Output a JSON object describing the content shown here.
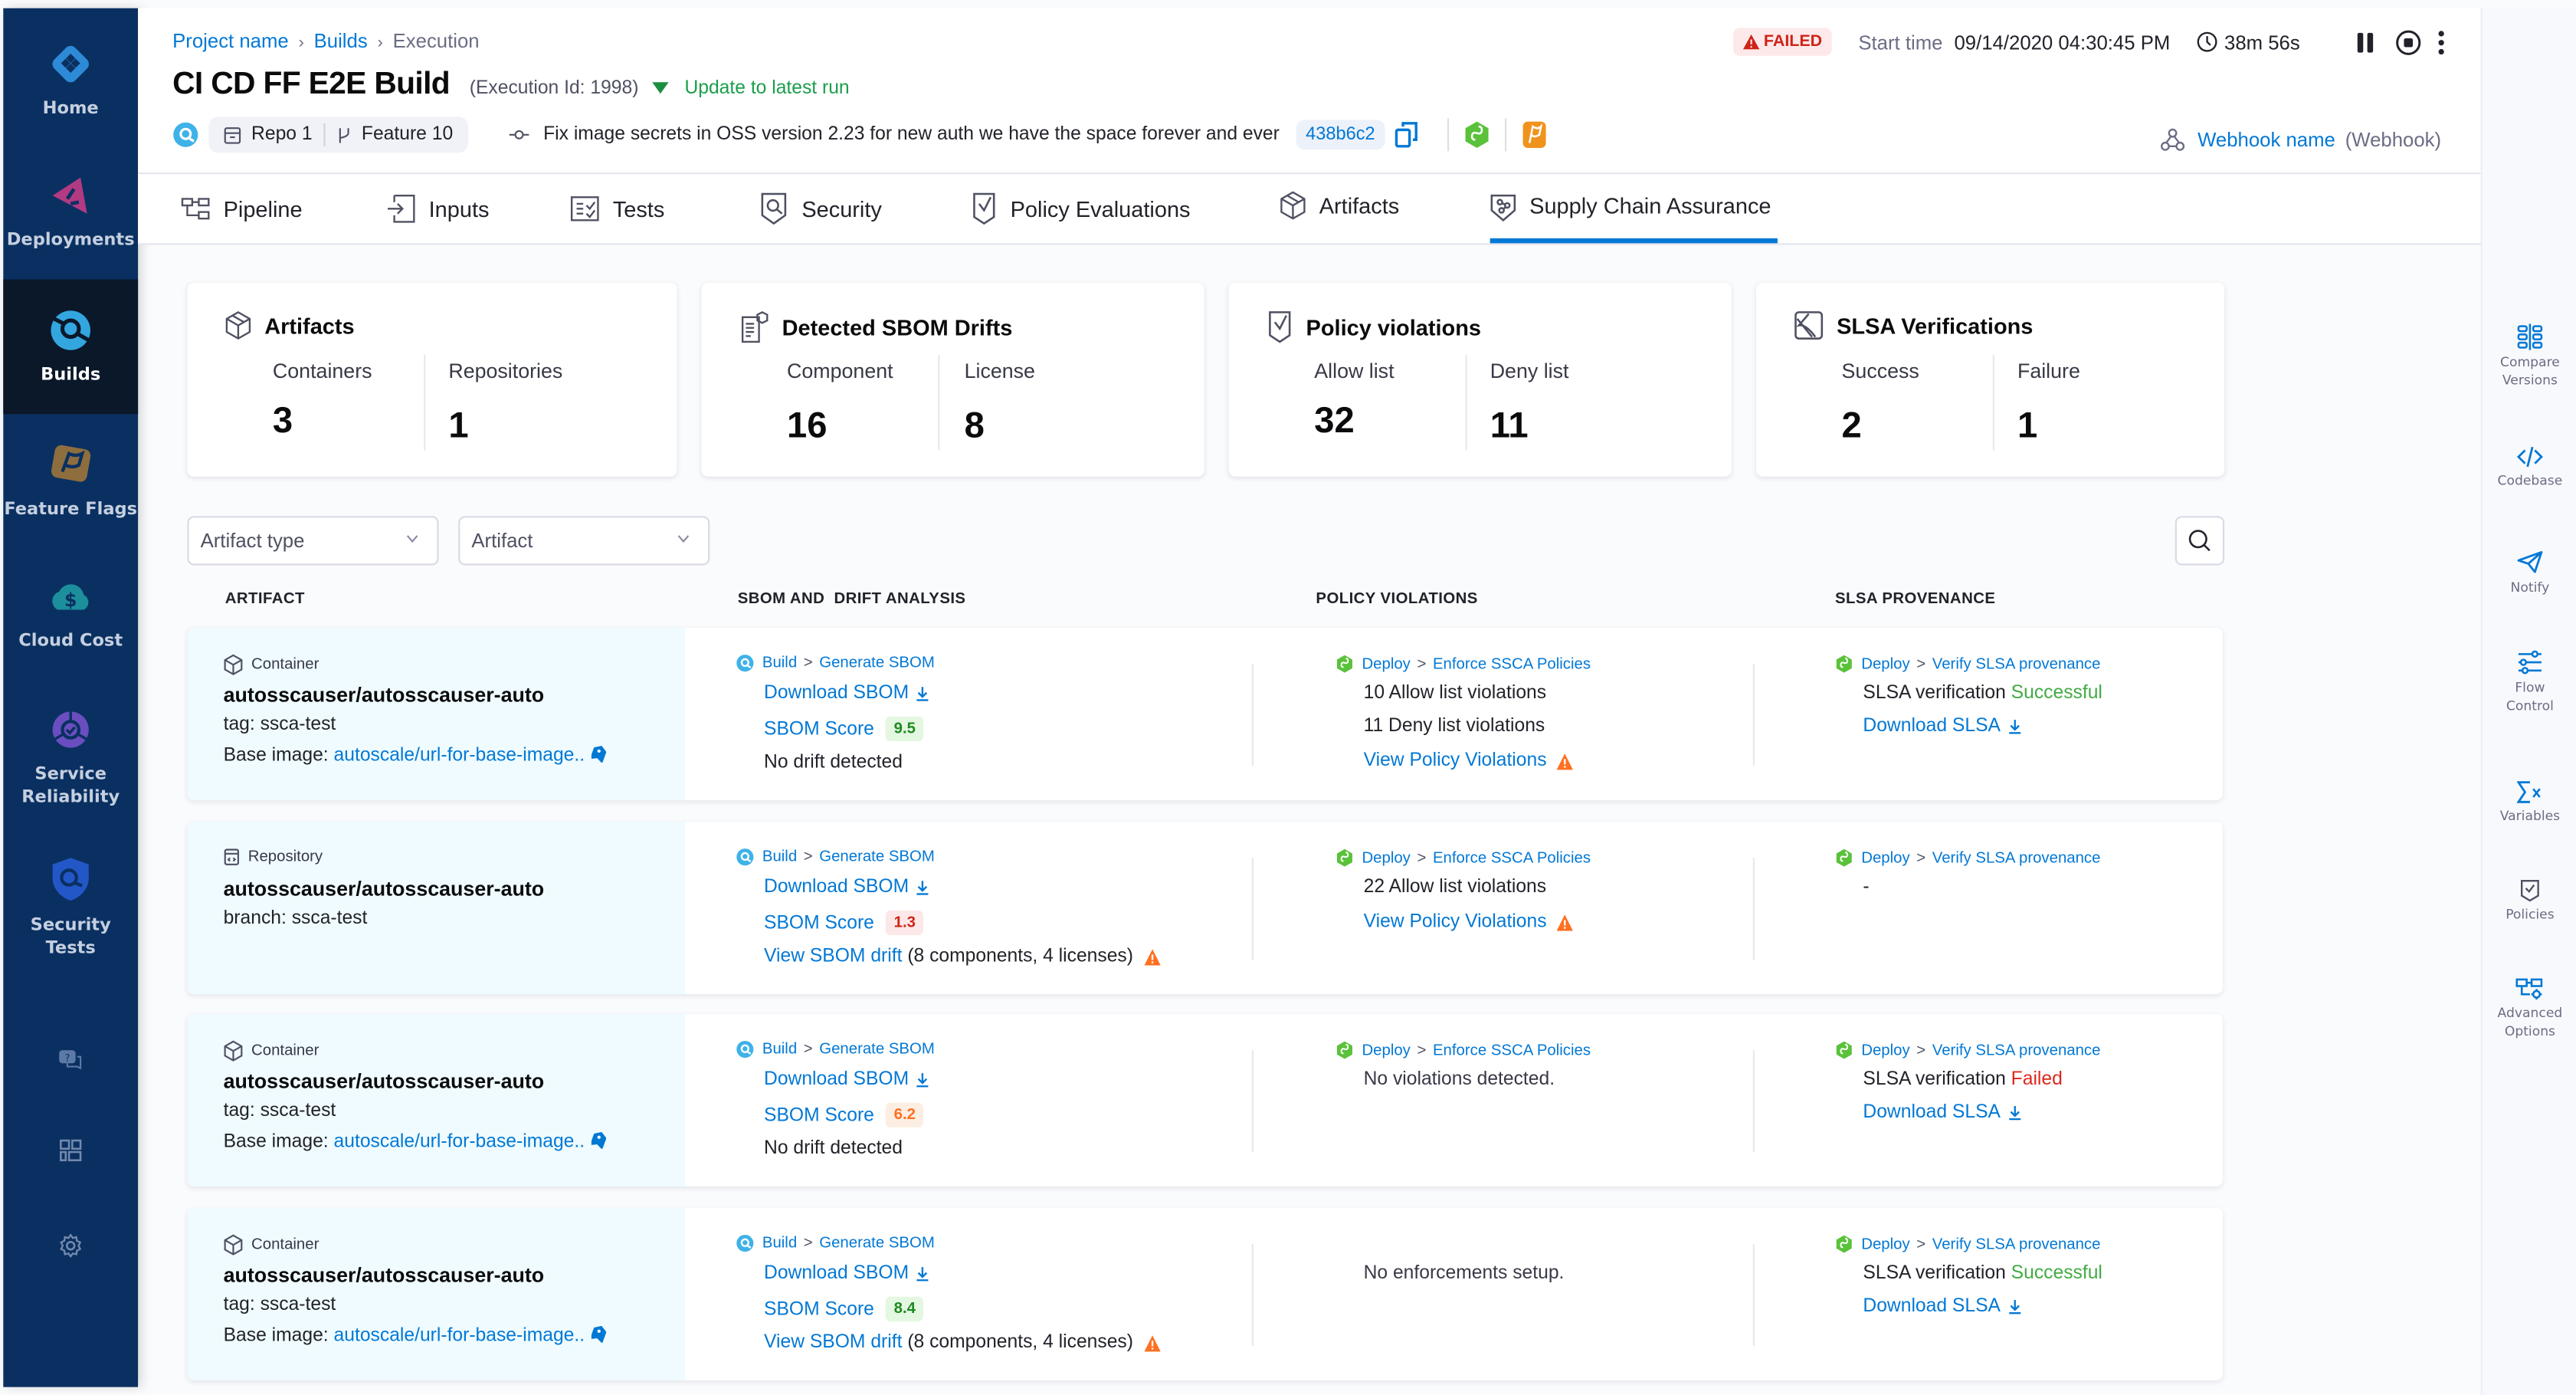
{
  "leftnav": {
    "items": [
      {
        "label": "Home",
        "icon": "home-icon"
      },
      {
        "label": "Deployments",
        "icon": "deployments-icon"
      },
      {
        "label": "Builds",
        "icon": "builds-icon",
        "active": true
      },
      {
        "label": "Feature Flags",
        "icon": "feature-flags-icon"
      },
      {
        "label": "Cloud Cost",
        "icon": "cloud-cost-icon"
      },
      {
        "label": "Service Reliability",
        "icon": "service-reliability-icon"
      },
      {
        "label": "Security Tests",
        "icon": "security-tests-icon"
      }
    ],
    "utility": [
      "help-icon",
      "dashboards-icon",
      "settings-icon"
    ]
  },
  "breadcrumb": [
    "Project name",
    "Builds",
    "Execution"
  ],
  "header": {
    "title": "CI CD FF E2E Build",
    "execution_id": "(Execution Id: 1998)",
    "update_link": "Update to latest run",
    "repo": "Repo 1",
    "branch": "Feature 10",
    "commit_message": "Fix image secrets in OSS version 2.23 for new auth we have the space forever and ever",
    "commit_sha": "438b6c2",
    "status": "FAILED",
    "start_time_label": "Start time",
    "start_time": "09/14/2020 04:30:45 PM",
    "duration": "38m 56s",
    "webhook_name": "Webhook name",
    "webhook_type": "(Webhook)"
  },
  "tabs": [
    {
      "label": "Pipeline",
      "icon": "pipeline-icon"
    },
    {
      "label": "Inputs",
      "icon": "inputs-icon"
    },
    {
      "label": "Tests",
      "icon": "tests-icon"
    },
    {
      "label": "Security",
      "icon": "security-icon"
    },
    {
      "label": "Policy Evaluations",
      "icon": "policy-icon"
    },
    {
      "label": "Artifacts",
      "icon": "artifacts-icon"
    },
    {
      "label": "Supply Chain Assurance",
      "icon": "supply-chain-icon",
      "active": true
    }
  ],
  "summary": [
    {
      "title": "Artifacts",
      "stats": [
        {
          "label": "Containers",
          "value": "3"
        },
        {
          "label": "Repositories",
          "value": "1"
        }
      ]
    },
    {
      "title": "Detected SBOM Drifts",
      "stats": [
        {
          "label": "Component",
          "value": "16"
        },
        {
          "label": "License",
          "value": "8"
        }
      ]
    },
    {
      "title": "Policy violations",
      "stats": [
        {
          "label": "Allow list",
          "value": "32"
        },
        {
          "label": "Deny list",
          "value": "11"
        }
      ]
    },
    {
      "title": "SLSA Verifications",
      "stats": [
        {
          "label": "Success",
          "value": "2"
        },
        {
          "label": "Failure",
          "value": "1"
        }
      ]
    }
  ],
  "filters": {
    "artifact_type": "Artifact type",
    "artifact": "Artifact"
  },
  "table": {
    "headers": [
      "ARTIFACT",
      "SBOM AND  DRIFT ANALYSIS",
      "POLICY VIOLATIONS",
      "SLSA PROVENANCE"
    ],
    "rows": [
      {
        "kind": "Container",
        "name": "autosscauser/autosscauser-auto",
        "line1_label": "tag:",
        "line1_value": "ssca-test",
        "base_label": "Base image:",
        "base_value": "autoscale/url-for-base-image..",
        "sbom_step": [
          "Build",
          "Generate SBOM"
        ],
        "download_sbom": "Download SBOM",
        "score_label": "SBOM Score",
        "score": "9.5",
        "score_level": "good",
        "drift_text": "No drift detected",
        "drift_link": "",
        "drift_detail": "",
        "policy_step": [
          "Deploy",
          "Enforce SSCA Policies"
        ],
        "policy_lines": [
          "10 Allow list violations",
          "11 Deny list violations"
        ],
        "policy_link": "View Policy Violations",
        "policy_empty": "",
        "slsa_step": [
          "Deploy",
          "Verify SLSA provenance"
        ],
        "slsa_label": "SLSA verification",
        "slsa_status": "Successful",
        "slsa_ok": true,
        "slsa_download": "Download SLSA"
      },
      {
        "kind": "Repository",
        "name": "autosscauser/autosscauser-auto",
        "line1_label": "branch:",
        "line1_value": "ssca-test",
        "base_label": "",
        "base_value": "",
        "sbom_step": [
          "Build",
          "Generate SBOM"
        ],
        "download_sbom": "Download SBOM",
        "score_label": "SBOM Score",
        "score": "1.3",
        "score_level": "bad",
        "drift_text": "",
        "drift_link": "View SBOM drift",
        "drift_detail": "(8 components, 4 licenses)",
        "policy_step": [
          "Deploy",
          "Enforce SSCA Policies"
        ],
        "policy_lines": [
          "22 Allow list violations"
        ],
        "policy_link": "View Policy Violations",
        "policy_empty": "",
        "slsa_step": [
          "Deploy",
          "Verify SLSA provenance"
        ],
        "slsa_label": "-",
        "slsa_status": "",
        "slsa_ok": true,
        "slsa_download": ""
      },
      {
        "kind": "Container",
        "name": "autosscauser/autosscauser-auto",
        "line1_label": "tag:",
        "line1_value": "ssca-test",
        "base_label": "Base image:",
        "base_value": "autoscale/url-for-base-image..",
        "sbom_step": [
          "Build",
          "Generate SBOM"
        ],
        "download_sbom": "Download SBOM",
        "score_label": "SBOM Score",
        "score": "6.2",
        "score_level": "mid",
        "drift_text": "No drift detected",
        "drift_link": "",
        "drift_detail": "",
        "policy_step": [
          "Deploy",
          "Enforce SSCA Policies"
        ],
        "policy_lines": [],
        "policy_link": "",
        "policy_empty": "No violations detected.",
        "slsa_step": [
          "Deploy",
          "Verify SLSA provenance"
        ],
        "slsa_label": "SLSA verification",
        "slsa_status": "Failed",
        "slsa_ok": false,
        "slsa_download": "Download SLSA"
      },
      {
        "kind": "Container",
        "name": "autosscauser/autosscauser-auto",
        "line1_label": "tag:",
        "line1_value": "ssca-test",
        "base_label": "Base image:",
        "base_value": "autoscale/url-for-base-image..",
        "sbom_step": [
          "Build",
          "Generate SBOM"
        ],
        "download_sbom": "Download SBOM",
        "score_label": "SBOM Score",
        "score": "8.4",
        "score_level": "good",
        "drift_text": "",
        "drift_link": "View SBOM drift",
        "drift_detail": "(8 components, 4 licenses)",
        "policy_step": [],
        "policy_lines": [],
        "policy_link": "",
        "policy_empty": "No enforcements setup.",
        "slsa_step": [
          "Deploy",
          "Verify SLSA provenance"
        ],
        "slsa_label": "SLSA verification",
        "slsa_status": "Successful",
        "slsa_ok": true,
        "slsa_download": "Download SLSA"
      }
    ]
  },
  "rail": [
    {
      "label": "Compare Versions",
      "icon": "compare-versions-icon"
    },
    {
      "label": "Codebase",
      "icon": "codebase-icon"
    },
    {
      "label": "Notify",
      "icon": "notify-icon"
    },
    {
      "label": "Flow Control",
      "icon": "flow-control-icon"
    },
    {
      "label": "Variables",
      "icon": "variables-icon"
    },
    {
      "label": "Policies",
      "icon": "policies-icon"
    },
    {
      "label": "Advanced Options",
      "icon": "advanced-options-icon"
    }
  ],
  "colors": {
    "brand_nav": "#0a3061",
    "link": "#0278d5",
    "success": "#42ab45",
    "failure": "#da291d",
    "warning": "#ff7020"
  }
}
